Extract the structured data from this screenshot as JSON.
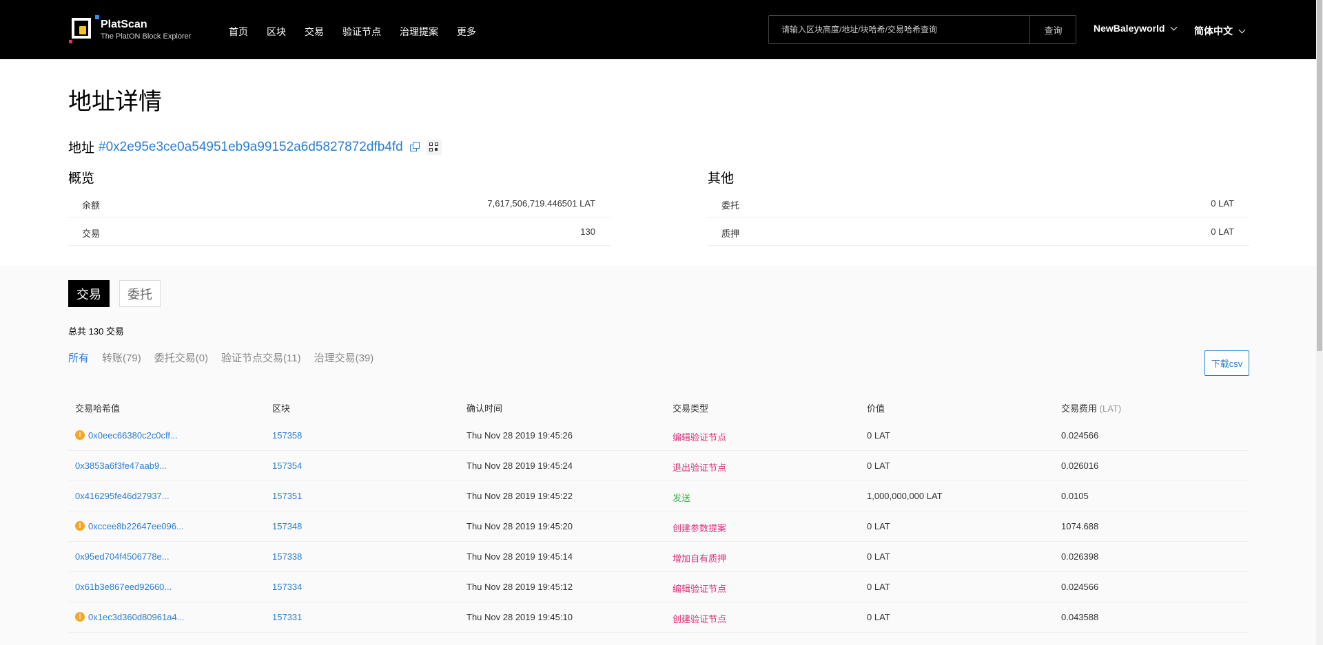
{
  "header": {
    "brand_name": "PlatScan",
    "brand_sub": "The PlatON Block Explorer",
    "nav": [
      "首页",
      "区块",
      "交易",
      "验证节点",
      "治理提案",
      "更多"
    ],
    "search_placeholder": "请输入区块高度/地址/块哈希/交易哈希查询",
    "search_button": "查询",
    "network": "NewBaleyworld",
    "language": "简体中文"
  },
  "page": {
    "title": "地址详情",
    "address_label": "地址",
    "address": "#0x2e95e3ce0a54951eb9a99152a6d5827872dfb4fd"
  },
  "overview": {
    "title": "概览",
    "rows": [
      {
        "key": "余额",
        "value": "7,617,506,719.446501 LAT"
      },
      {
        "key": "交易",
        "value": "130"
      }
    ]
  },
  "other": {
    "title": "其他",
    "rows": [
      {
        "key": "委托",
        "value": "0 LAT"
      },
      {
        "key": "质押",
        "value": "0 LAT"
      }
    ]
  },
  "tabs": [
    "交易",
    "委托"
  ],
  "total_text": "总共 130 交易",
  "filters": [
    "所有",
    "转账(79)",
    "委托交易(0)",
    "验证节点交易(11)",
    "治理交易(39)"
  ],
  "csv_button": "下载csv",
  "table": {
    "headers": [
      "交易哈希值",
      "区块",
      "确认时间",
      "交易类型",
      "价值",
      "交易费用"
    ],
    "fee_unit": "(LAT)",
    "rows": [
      {
        "hash": "0x0eec66380c2c0cff...",
        "block": "157358",
        "time": "Thu Nov 28 2019 19:45:26",
        "type": "编辑验证节点",
        "value": "0 LAT",
        "fee": "0.024566"
      },
      {
        "hash": "0x3853a6f3fe47aab9...",
        "block": "157354",
        "time": "Thu Nov 28 2019 19:45:24",
        "type": "退出验证节点",
        "value": "0 LAT",
        "fee": "0.026016"
      },
      {
        "hash": "0x416295fe46d27937...",
        "block": "157351",
        "time": "Thu Nov 28 2019 19:45:22",
        "type": "发送",
        "value": "1,000,000,000 LAT",
        "fee": "0.0105"
      },
      {
        "hash": "0xccee8b22647ee096...",
        "block": "157348",
        "time": "Thu Nov 28 2019 19:45:20",
        "type": "创建参数提案",
        "value": "0 LAT",
        "fee": "1074.688"
      },
      {
        "hash": "0x95ed704f4506778e...",
        "block": "157338",
        "time": "Thu Nov 28 2019 19:45:14",
        "type": "增加自有质押",
        "value": "0 LAT",
        "fee": "0.026398"
      },
      {
        "hash": "0x61b3e867eed92660...",
        "block": "157334",
        "time": "Thu Nov 28 2019 19:45:12",
        "type": "编辑验证节点",
        "value": "0 LAT",
        "fee": "0.024566"
      },
      {
        "hash": "0x1ec3d360d80961a4...",
        "block": "157331",
        "time": "Thu Nov 28 2019 19:45:10",
        "type": "创建验证节点",
        "value": "0 LAT",
        "fee": "0.043588"
      }
    ]
  },
  "colors": {
    "accent": "#2a7ed3",
    "type_red": "#d8327a",
    "type_green": "#3db34a",
    "warning": "#f5a623"
  }
}
